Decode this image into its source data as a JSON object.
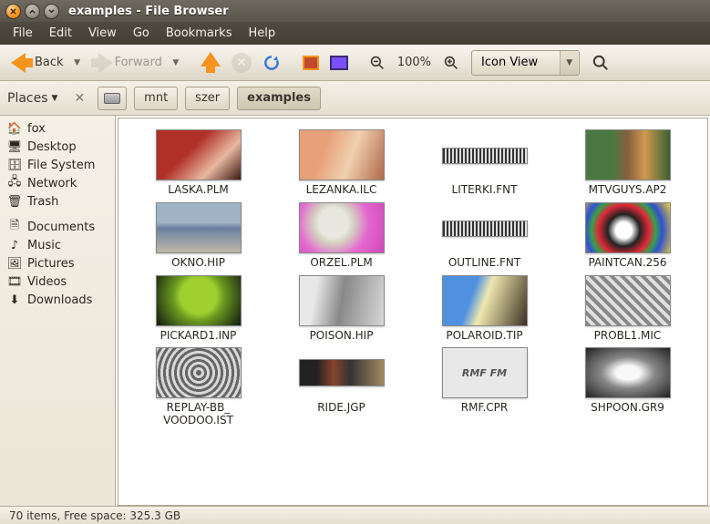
{
  "window": {
    "title": "examples - File Browser"
  },
  "menu": {
    "file": "File",
    "edit": "Edit",
    "view": "View",
    "go": "Go",
    "bookmarks": "Bookmarks",
    "help": "Help"
  },
  "toolbar": {
    "back": "Back",
    "forward": "Forward",
    "zoom": "100%",
    "view_mode": "Icon View"
  },
  "locbar": {
    "places": "Places",
    "path": {
      "mnt": "mnt",
      "szer": "szer",
      "examples": "examples"
    }
  },
  "sidebar": {
    "fox": "fox",
    "desktop": "Desktop",
    "filesystem": "File System",
    "network": "Network",
    "trash": "Trash",
    "documents": "Documents",
    "music": "Music",
    "pictures": "Pictures",
    "videos": "Videos",
    "downloads": "Downloads"
  },
  "files": {
    "laska": "LASKA.PLM",
    "lezanka": "LEZANKA.ILC",
    "literki": "LITERKI.FNT",
    "mtv": "MTVGUYS.AP2",
    "okno": "OKNO.HIP",
    "orzel": "ORZEL.PLM",
    "outline": "OUTLINE.FNT",
    "paintcan": "PAINTCAN.256",
    "pickard": "PICKARD1.INP",
    "poison": "POISON.HIP",
    "polaroid": "POLAROID.TIP",
    "probl": "PROBL1.MIC",
    "replay": "REPLAY-BB_\nVOODOO.IST",
    "ride": "RIDE.JGP",
    "rmf": "RMF.CPR",
    "shpoon": "SHPOON.GR9"
  },
  "rmf_thumb_text": "RMF FM",
  "status": "70 items, Free space: 325.3 GB"
}
